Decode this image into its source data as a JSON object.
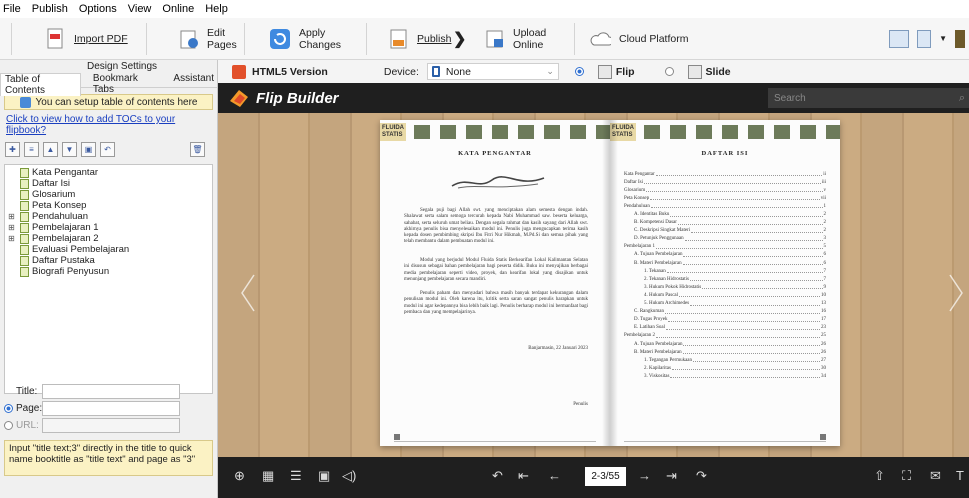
{
  "menu": [
    "File",
    "Publish",
    "Options",
    "View",
    "Online",
    "Help"
  ],
  "toolbar": {
    "import_pdf": "Import PDF",
    "edit_pages": "Edit Pages",
    "apply_changes": "Apply Changes",
    "publish": "Publish",
    "upload_online": "Upload Online",
    "cloud_platform": "Cloud Platform"
  },
  "left_panel": {
    "design_settings": "Design Settings",
    "tabs": [
      "Table of Contents",
      "Bookmark Tabs",
      "Assistant"
    ],
    "tip": "You can setup table of contents here",
    "howto_link": "Click to view how to add TOCs to your flipbook?",
    "tree": [
      {
        "label": "Kata Pengantar",
        "expandable": false
      },
      {
        "label": "Daftar Isi",
        "expandable": false
      },
      {
        "label": "Glosarium",
        "expandable": false
      },
      {
        "label": "Peta Konsep",
        "expandable": false
      },
      {
        "label": "Pendahuluan",
        "expandable": true
      },
      {
        "label": "Pembelajaran 1",
        "expandable": true
      },
      {
        "label": "Pembelajaran 2",
        "expandable": true
      },
      {
        "label": "Evaluasi Pembelajaran",
        "expandable": false
      },
      {
        "label": "Daftar Pustaka",
        "expandable": false
      },
      {
        "label": "Biografi Penyusun",
        "expandable": false
      }
    ],
    "title_label": "Title:",
    "page_label": "Page:",
    "url_label": "URL:",
    "hint": "Input \"title text;3\" directly in the title to quick name booktitle as \"title text\" and page as \"3\""
  },
  "viewbar": {
    "html5_version": "HTML5 Version",
    "device_label": "Device:",
    "device_value": "None",
    "flip": "Flip",
    "slide": "Slide"
  },
  "preview": {
    "brand": "Flip Builder",
    "search_placeholder": "Search",
    "page_indicator": "2-3/55"
  },
  "book": {
    "tag": "FLUIDA STATIS",
    "left": {
      "title": "KATA PENGANTAR",
      "paragraphs": [
        "Segala puji bagi Allah swt. yang menciptakan alam semesta dengan indah. Shalawat serta salam semoga tercurah kepada Nabi Muhammad saw. beserta keluarga, sahabat, serta seluruh umat beliau. Dengan segala rahmat dan kasih sayang dari Allah swt. akhirnya penulis bisa menyelesaikan modul ini. Penulis juga mengucapkan terima kasih kepada dosen pembimbing skripsi Ibu Fitri Nur Hikmah, M.Pd.Si dan semua pihak yang telah membantu dalam pembuatan modul ini.",
        "Modul yang berjudul Modul Fluida Statis Berkearifan Lokal Kalimantan Selatan ini disusun sebagai bahan pembelajaran bagi peserta didik. Buku ini menyajikan berbagai media pembelajaran seperti video, proyek, dan kearifan lokal yang disajikan untuk menunjang pembelajaran secara mandiri.",
        "Penulis paham dan menyadari bahwa masih banyak terdapat kekurangan dalam penulisan modul ini. Oleh karena itu, kritik serta saran sangat penulis harapkan untuk modul ini agar kedepannya bisa lebih baik lagi. Penulis berharap modul ini bermanfaat bagi pembaca dan yang mempelajarinya."
      ],
      "place_date": "Banjarmasin, 22 Januari 2023",
      "signature": "Penulis"
    },
    "right": {
      "title": "DAFTAR ISI",
      "toc": [
        {
          "t": "Kata Pengantar",
          "p": "ii",
          "lvl": 0
        },
        {
          "t": "Daftar Isi",
          "p": "iii",
          "lvl": 0
        },
        {
          "t": "Glosarium",
          "p": "v",
          "lvl": 0
        },
        {
          "t": "Peta Konsep",
          "p": "vii",
          "lvl": 0
        },
        {
          "t": "Pendahuluan",
          "p": "1",
          "lvl": 0
        },
        {
          "t": "A.  Identitas Buku",
          "p": "2",
          "lvl": 1
        },
        {
          "t": "B.  Kompetensi Dasar",
          "p": "2",
          "lvl": 1
        },
        {
          "t": "C.  Deskripsi Singkat Materi",
          "p": "2",
          "lvl": 1
        },
        {
          "t": "D.  Petunjuk Penggunaan",
          "p": "3",
          "lvl": 1
        },
        {
          "t": "Pembelajaran 1",
          "p": "5",
          "lvl": 0
        },
        {
          "t": "A.  Tujuan Pembelajaran",
          "p": "6",
          "lvl": 1
        },
        {
          "t": "B.  Materi Pembelajaran",
          "p": "6",
          "lvl": 1
        },
        {
          "t": "1.  Tekanan",
          "p": "7",
          "lvl": 2
        },
        {
          "t": "2.  Tekanan Hidrostatis",
          "p": "7",
          "lvl": 2
        },
        {
          "t": "3.  Hukum Pokok Hidrostatis",
          "p": "9",
          "lvl": 2
        },
        {
          "t": "4.  Hukum Pascal",
          "p": "10",
          "lvl": 2
        },
        {
          "t": "5.  Hukum Archimedes",
          "p": "13",
          "lvl": 2
        },
        {
          "t": "C.  Rangkuman",
          "p": "16",
          "lvl": 1
        },
        {
          "t": "D.  Tugas Proyek",
          "p": "17",
          "lvl": 1
        },
        {
          "t": "E.  Latihan Soal",
          "p": "23",
          "lvl": 1
        },
        {
          "t": "Pembelajaran 2",
          "p": "25",
          "lvl": 0
        },
        {
          "t": "A.  Tujuan Pembelajaran",
          "p": "26",
          "lvl": 1
        },
        {
          "t": "B.  Materi Pembelajaran",
          "p": "26",
          "lvl": 1
        },
        {
          "t": "1.  Tegangan Permukaan",
          "p": "27",
          "lvl": 2
        },
        {
          "t": "2.  Kapilaritas",
          "p": "30",
          "lvl": 2
        },
        {
          "t": "3.  Viskositas",
          "p": "34",
          "lvl": 2
        }
      ]
    }
  }
}
